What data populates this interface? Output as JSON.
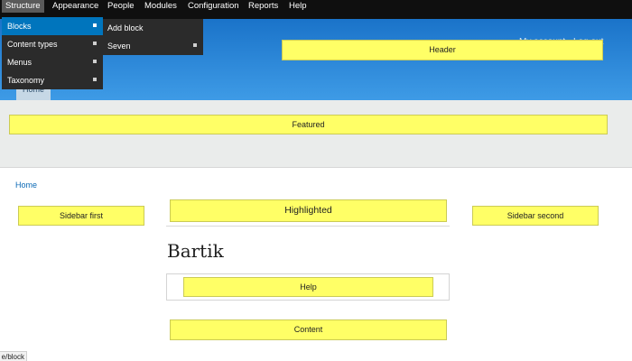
{
  "toolbar": {
    "items": [
      "Structure",
      "Appearance",
      "People",
      "Modules",
      "Configuration",
      "Reports",
      "Help"
    ]
  },
  "structure_menu": {
    "items": [
      "Blocks",
      "Content types",
      "Menus",
      "Taxonomy"
    ],
    "selected": "Blocks"
  },
  "blocks_submenu": {
    "items": [
      "Add block",
      "Seven"
    ]
  },
  "user_links": {
    "my_account": "My account",
    "log_out": "Log out"
  },
  "tabs": {
    "home": "Home"
  },
  "regions": {
    "header": "Header",
    "featured": "Featured",
    "sidebar_first": "Sidebar first",
    "highlighted": "Highlighted",
    "sidebar_second": "Sidebar second",
    "help": "Help",
    "content": "Content"
  },
  "breadcrumb": {
    "home": "Home"
  },
  "site": {
    "theme_title": "Bartik"
  },
  "status_bar": {
    "url": "e/block"
  },
  "colors": {
    "toolbar_bg": "#0f0f0f",
    "menu_bg": "#2b2b2b",
    "menu_selected": "#0075bd",
    "header_gradient_top": "#1a73c9",
    "header_gradient_bottom": "#3e9be6",
    "region_fill": "#ffff66",
    "link": "#0b69b5"
  }
}
